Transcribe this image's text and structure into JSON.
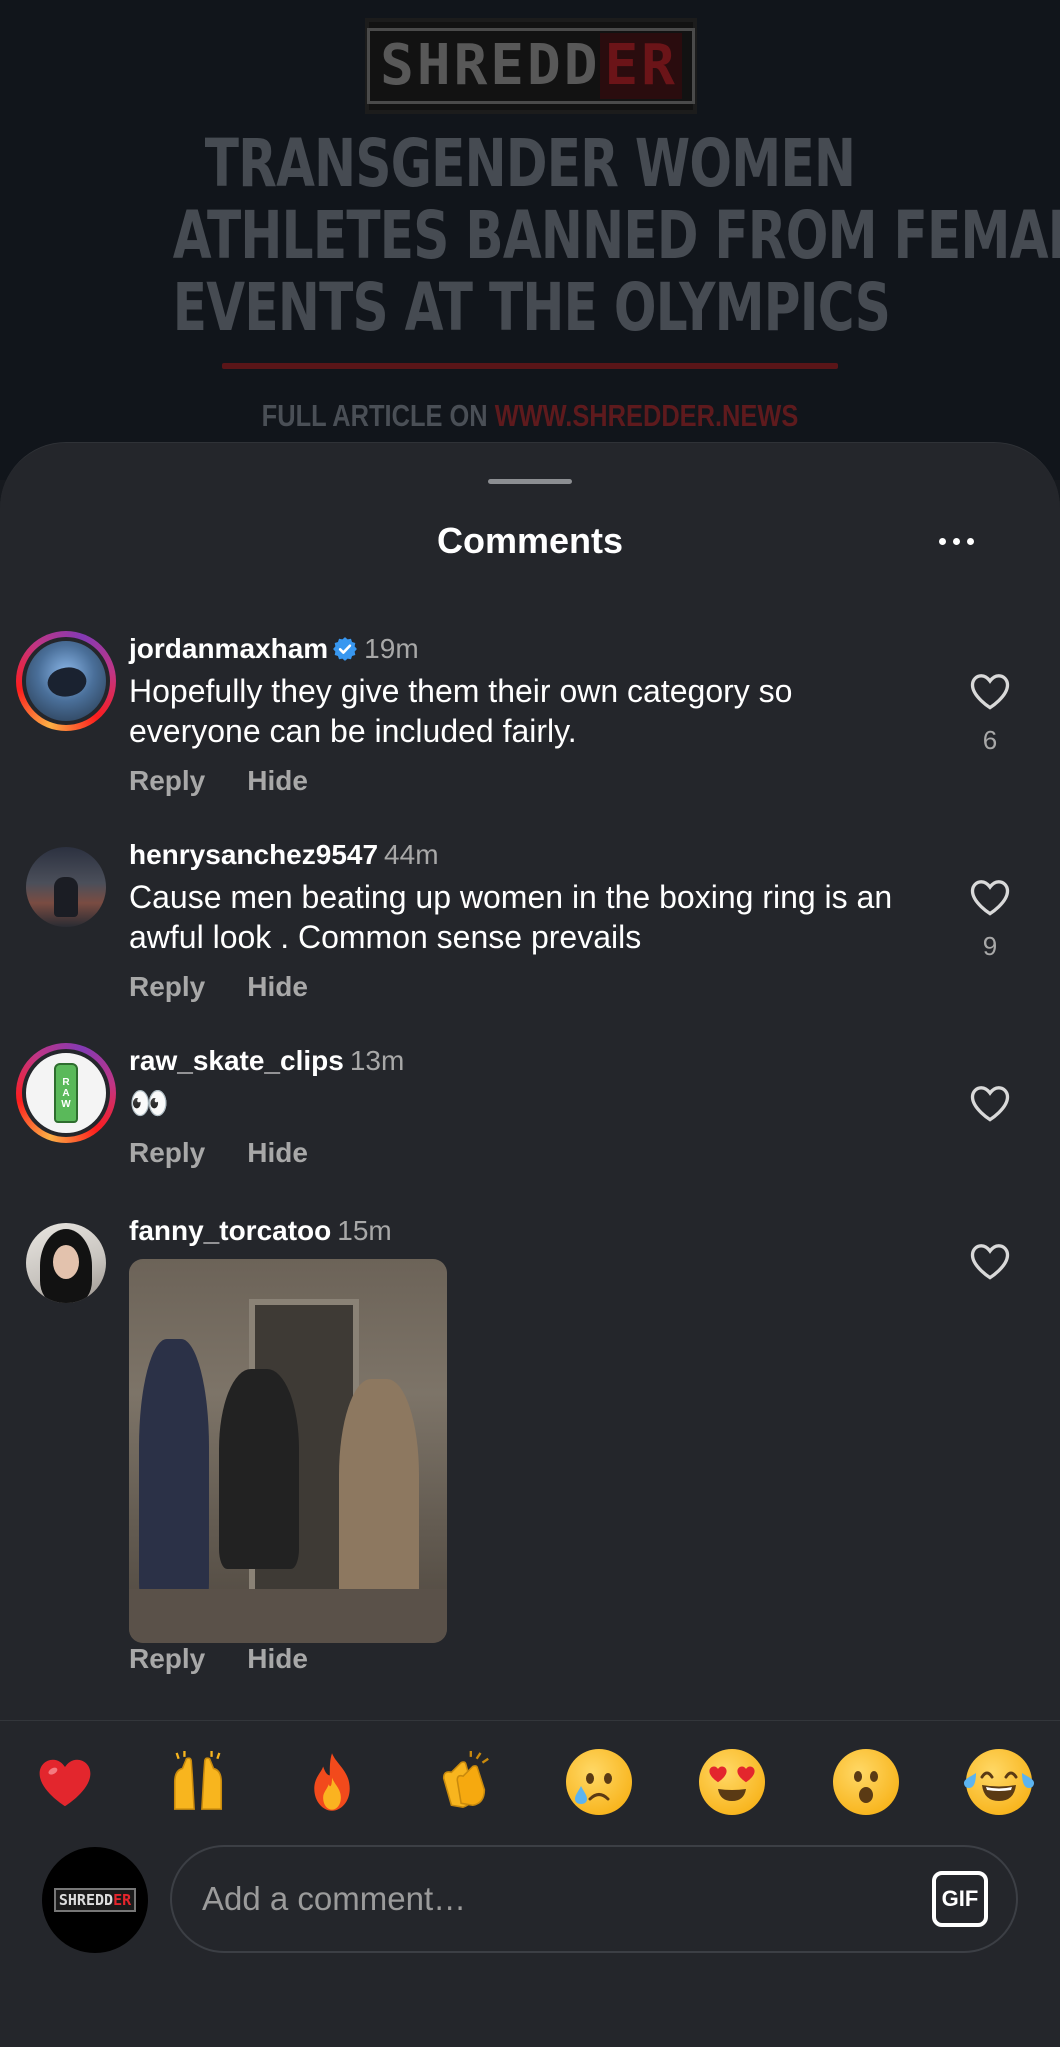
{
  "post": {
    "logo_left": "SHREDD",
    "logo_right": "ER",
    "headline_lines": [
      "TRANSGENDER WOMEN",
      "ATHLETES BANNED FROM FEMALE",
      "EVENTS AT THE OLYMPICS"
    ],
    "full_article_label": "FULL ARTICLE ON",
    "full_article_url": "WWW.SHREDDER.NEWS"
  },
  "sheet": {
    "title": "Comments"
  },
  "comments": [
    {
      "username": "jordanmaxham",
      "verified": true,
      "time": "19m",
      "text": "Hopefully they give them their own category so everyone can be included fairly.",
      "likes": "6",
      "reply_label": "Reply",
      "hide_label": "Hide",
      "avatar_icon": "skateboarder-avatar"
    },
    {
      "username": "henrysanchez9547",
      "verified": false,
      "time": "44m",
      "text": "Cause men beating up women in the boxing ring is an awful look . Common sense prevails",
      "likes": "9",
      "reply_label": "Reply",
      "hide_label": "Hide",
      "avatar_icon": "person-avatar"
    },
    {
      "username": "raw_skate_clips",
      "verified": false,
      "time": "13m",
      "text": "👀",
      "likes": "",
      "reply_label": "Reply",
      "hide_label": "Hide",
      "avatar_icon": "raw-can-avatar",
      "avatar_text": "RAW"
    },
    {
      "username": "fanny_torcatoo",
      "verified": false,
      "time": "15m",
      "text": "",
      "likes": "",
      "reply_label": "Reply",
      "hide_label": "Hide",
      "avatar_icon": "woman-avatar",
      "attachment": "celebration-gif"
    }
  ],
  "reactions": [
    "❤️",
    "🙌",
    "🔥",
    "👏",
    "😢",
    "😍",
    "😮",
    "😂"
  ],
  "composer": {
    "placeholder": "Add a comment…",
    "gif_label": "GIF",
    "avatar_logo_left": "SHREDD",
    "avatar_logo_right": "ER"
  },
  "colors": {
    "sheet_bg": "#24262b",
    "verified_blue": "#3897f0",
    "brand_red": "#e5252c"
  }
}
